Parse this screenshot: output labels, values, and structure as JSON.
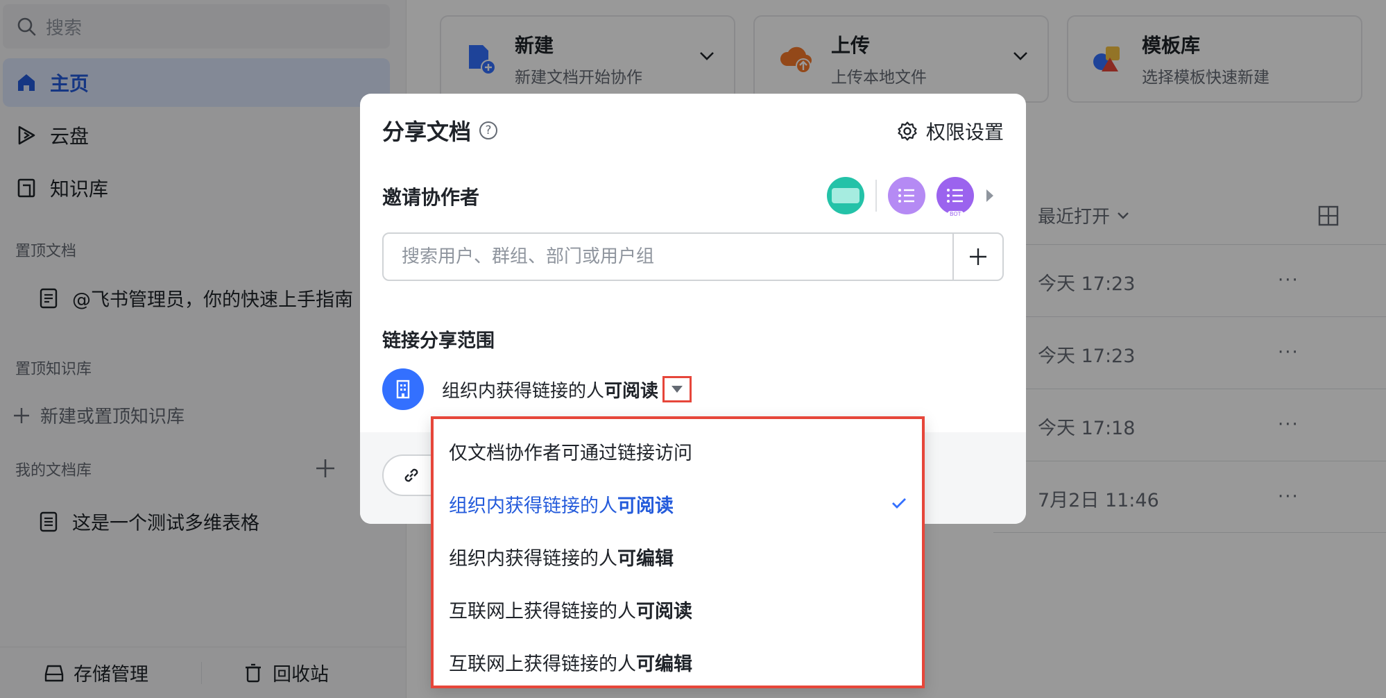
{
  "sidebar": {
    "search_label": "搜索",
    "nav": [
      {
        "label": "主页",
        "icon": "home-icon",
        "active": true
      },
      {
        "label": "云盘",
        "icon": "cloud-drive-icon"
      },
      {
        "label": "知识库",
        "icon": "knowledge-base-icon"
      }
    ],
    "pinned_docs_title": "置顶文档",
    "pinned_doc": "@飞书管理员，你的快速上手指南",
    "pinned_kb_title": "置顶知识库",
    "add_kb_label": "新建或置顶知识库",
    "my_library_title": "我的文档库",
    "my_library_doc": "这是一个测试多维表格",
    "storage_label": "存储管理",
    "trash_label": "回收站"
  },
  "main": {
    "cards": [
      {
        "title": "新建",
        "subtitle": "新建文档开始协作",
        "icon": "new-doc-icon"
      },
      {
        "title": "上传",
        "subtitle": "上传本地文件",
        "icon": "upload-cloud-icon"
      },
      {
        "title": "模板库",
        "subtitle": "选择模板快速新建",
        "icon": "template-library-icon"
      }
    ],
    "sort_label": "最近打开",
    "rows": [
      {
        "time": "今天 17:23"
      },
      {
        "time": "今天 17:23"
      },
      {
        "time": "今天 17:18"
      },
      {
        "time": "7月2日 11:46"
      }
    ],
    "more_label": "···"
  },
  "dialog": {
    "title": "分享文档",
    "help_glyph": "?",
    "permission_label": "权限设置",
    "invite_title": "邀请协作者",
    "invite_placeholder": "搜索用户、群组、部门或用户组",
    "bot_badge": "BOT",
    "scope_title": "链接分享范围",
    "scope_prefix": "组织内获得链接的人",
    "scope_access": "可阅读"
  },
  "menu": {
    "options": [
      {
        "prefix": "仅文档协作者可通过链接访问",
        "access": "",
        "selected": false
      },
      {
        "prefix": "组织内获得链接的人",
        "access": "可阅读",
        "selected": true
      },
      {
        "prefix": "组织内获得链接的人",
        "access": "可编辑",
        "selected": false
      },
      {
        "prefix": "互联网上获得链接的人",
        "access": "可阅读",
        "selected": false
      },
      {
        "prefix": "互联网上获得链接的人",
        "access": "可编辑",
        "selected": false
      }
    ]
  },
  "colors": {
    "accent": "#3370ff",
    "selected_text": "#245bdb",
    "highlight_outline": "#e6463a"
  }
}
